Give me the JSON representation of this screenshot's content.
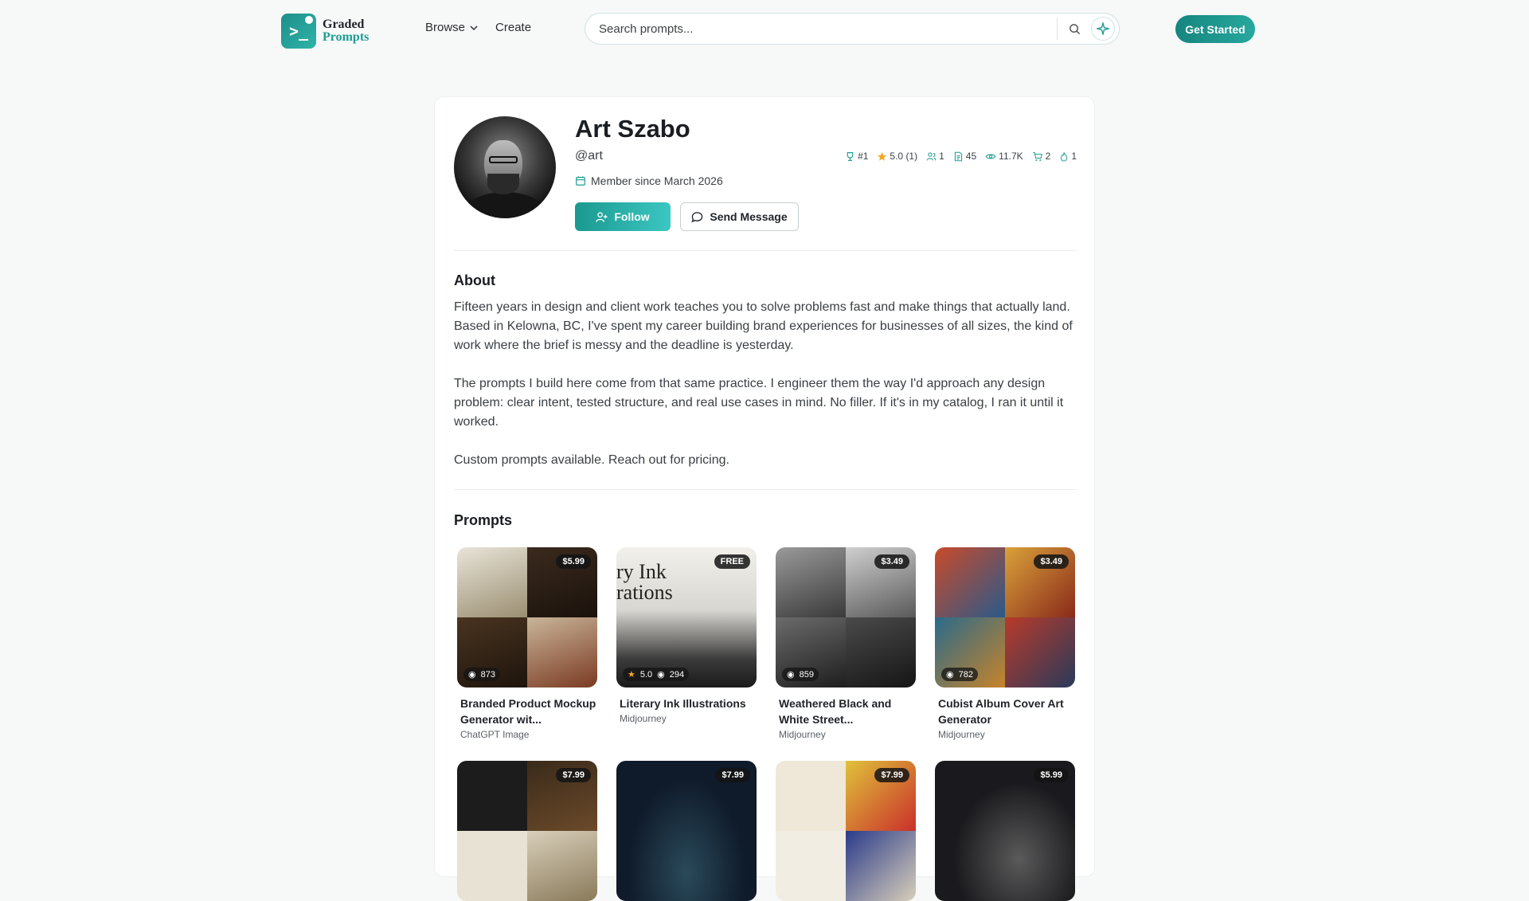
{
  "header": {
    "logo_line1": "Graded",
    "logo_line2": "Prompts",
    "nav": [
      {
        "label": "Browse"
      },
      {
        "label": "Create"
      }
    ],
    "search_placeholder": "Search prompts...",
    "cta_label": "Get Started"
  },
  "profile": {
    "name": "Art Szabo",
    "handle": "@art",
    "member_since": "Member since March 2026",
    "stats": {
      "rank": "#1",
      "rating": "5.0 (1)",
      "followers": "1",
      "prompts": "45",
      "views": "11.7K",
      "sales": "2",
      "favorites": "1"
    },
    "follow_label": "Follow",
    "message_label": "Send Message"
  },
  "about": {
    "heading": "About",
    "p1": "Fifteen years in design and client work teaches you to solve problems fast and make things that actually land. Based in Kelowna, BC, I've spent my career building brand experiences for businesses of all sizes, the kind of work where the brief is messy and the deadline is yesterday.",
    "p2": "The prompts I build here come from that same practice. I engineer them the way I'd approach any design problem: clear intent, tested structure, and real use cases in mind. No filler. If it's in my catalog, I ran it until it worked.",
    "p3": "Custom prompts available. Reach out for pricing."
  },
  "prompts": {
    "heading": "Prompts",
    "items": [
      {
        "title": "Branded Product Mockup Generator wit...",
        "category": "ChatGPT Image",
        "price": "$5.99",
        "views": "873",
        "rating": ""
      },
      {
        "title": "Literary Ink Illustrations",
        "category": "Midjourney",
        "price": "FREE",
        "views": "294",
        "rating": "5.0"
      },
      {
        "title": "Weathered Black and White Street...",
        "category": "Midjourney",
        "price": "$3.49",
        "views": "859",
        "rating": ""
      },
      {
        "title": "Cubist Album Cover Art Generator",
        "category": "Midjourney",
        "price": "$3.49",
        "views": "782",
        "rating": ""
      },
      {
        "title": "",
        "category": "",
        "price": "$7.99",
        "views": "",
        "rating": ""
      },
      {
        "title": "",
        "category": "",
        "price": "$7.99",
        "views": "",
        "rating": ""
      },
      {
        "title": "",
        "category": "",
        "price": "$7.99",
        "views": "",
        "rating": ""
      },
      {
        "title": "",
        "category": "",
        "price": "$5.99",
        "views": "",
        "rating": ""
      }
    ]
  },
  "colors": {
    "brand": "#1f9d93",
    "accent_gradient_start": "#1a9990",
    "accent_gradient_end": "#3cc7c2",
    "star": "#f5a623"
  }
}
